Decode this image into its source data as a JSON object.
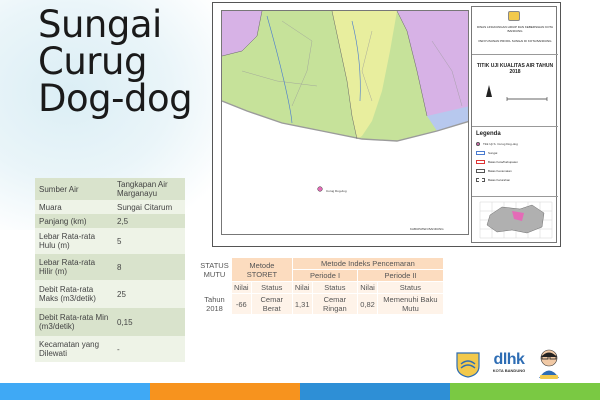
{
  "title_lines": [
    "Sungai",
    "Curug",
    "Dog-dog"
  ],
  "info_rows": [
    {
      "key": "Sumber Air",
      "value": "Tangkapan Air Marganayu"
    },
    {
      "key": "Muara",
      "value": "Sungai Citarum"
    },
    {
      "key": "Panjang (km)",
      "value": "2,5"
    },
    {
      "key": "Lebar Rata-rata Hulu (m)",
      "value": "5"
    },
    {
      "key": "Lebar Rata-rata Hilir (m)",
      "value": "8"
    },
    {
      "key": "Debit Rata-rata Maks (m3/detik)",
      "value": "25"
    },
    {
      "key": "Debit Rata-rata Min (m3/detik)",
      "value": "0,15"
    },
    {
      "key": "Kecamatan yang Dilewati",
      "value": "-"
    }
  ],
  "map": {
    "legend_org": "DINAS LINGKUNGAN HIDUP DAN KEBERSIHAN KOTA BANDUNG",
    "legend_project": "PENYUSUNAN PROFIL SUNGAI DI KOTA BANDUNG",
    "legend_title": "TITIK UJI KUALITAS AIR TAHUN 2018",
    "legend_heading": "Legenda",
    "legend_items": [
      "Titik Uji S. Curug Dog-dog",
      "Sungai",
      "Batas Kota/Kabupaten",
      "Batas Kecamatan",
      "Batas Kelurahan"
    ],
    "point_label": "Curug Dog-dog",
    "caption": "KABUPATEN BANDUNG",
    "colors": {
      "green": "#c6e29a",
      "purple": "#d7b2e6",
      "blue": "#b7c8ee",
      "pink": "#e46bb7",
      "gray": "#b0b0b0"
    }
  },
  "status_table": {
    "status_mutu": "STATUS MUTU",
    "metode_storet": "Metode STORET",
    "metode_ip": "Metode Indeks Pencemaran",
    "periode_1": "Periode I",
    "periode_2": "Periode II",
    "nilai": "Nilai",
    "status": "Status",
    "row": {
      "year": "Tahun 2018",
      "storet_nilai": "-66",
      "storet_status": "Cemar Berat",
      "p1_nilai": "1,31",
      "p1_status": "Cemar Ringan",
      "p2_nilai": "0,82",
      "p2_status": "Memenuhi Baku Mutu"
    }
  },
  "logos": {
    "dlhk_text": "dlhk",
    "dlhk_sub": "KOTA BANDUNG",
    "crest_text": "KOTA BANDUNG"
  },
  "bar_colors": [
    "#3fa9f5",
    "#f7931e",
    "#2e8fd6",
    "#7ac943"
  ]
}
